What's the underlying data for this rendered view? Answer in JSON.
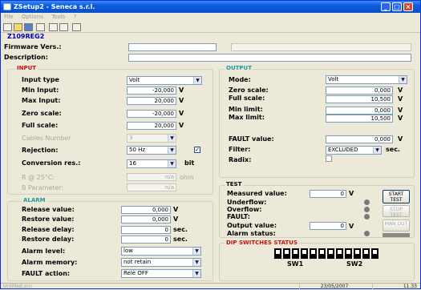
{
  "window": {
    "title": "ZSetup2 - Seneca s.r.l."
  },
  "menu": [
    "File",
    "Options",
    "Tools",
    "?"
  ],
  "device": {
    "model": "Z109REG2"
  },
  "header": {
    "firmware_label": "Firmware Vers.:",
    "description_label": "Description:",
    "firmware_value": "",
    "description_value": ""
  },
  "input": {
    "title": "INPUT",
    "input_type_label": "Input type",
    "input_type_value": "Volt",
    "min_input_label": "Min Input:",
    "min_input_value": "-20,000",
    "min_input_unit": "V",
    "max_input_label": "Max Input:",
    "max_input_value": "20,000",
    "max_input_unit": "V",
    "zero_scale_label": "Zero scale:",
    "zero_scale_value": "-20,000",
    "zero_scale_unit": "V",
    "full_scale_label": "Full scale:",
    "full_scale_value": "20,000",
    "full_scale_unit": "V",
    "cables_label": "Cables Number",
    "cables_value": "3",
    "rejection_label": "Rejection:",
    "rejection_value": "50 Hz",
    "conversion_label": "Conversion res.:",
    "conversion_value": "16",
    "conversion_unit": "bit",
    "r25_label": "R @ 25°C:",
    "r25_value": "n/a",
    "r25_unit": "ohm",
    "b_param_label": "B Parameter:",
    "b_param_value": "n/a"
  },
  "alarm": {
    "title": "ALARM",
    "release_value_label": "Release value:",
    "release_value": "0,000",
    "release_unit": "V",
    "restore_value_label": "Restore value:",
    "restore_value": "0,000",
    "restore_unit": "V",
    "release_delay_label": "Release delay:",
    "release_delay": "0",
    "release_delay_unit": "sec.",
    "restore_delay_label": "Restore delay:",
    "restore_delay": "0",
    "restore_delay_unit": "sec.",
    "alarm_level_label": "Alarm level:",
    "alarm_level_value": "low",
    "alarm_memory_label": "Alarm memory:",
    "alarm_memory_value": "not retain",
    "fault_action_label": "FAULT action:",
    "fault_action_value": "Relè OFF"
  },
  "output": {
    "title": "OUTPUT",
    "mode_label": "Mode:",
    "mode_value": "Volt",
    "zero_scale_label": "Zero scale:",
    "zero_scale_value": "0,000",
    "zero_scale_unit": "V",
    "full_scale_label": "Full scale:",
    "full_scale_value": "10,500",
    "full_scale_unit": "V",
    "min_limit_label": "Min limit:",
    "min_limit_value": "0,000",
    "min_limit_unit": "V",
    "max_limit_label": "Max limit:",
    "max_limit_value": "10,500",
    "max_limit_unit": "V",
    "fault_value_label": "FAULT value:",
    "fault_value": "0,000",
    "fault_value_unit": "V",
    "filter_label": "Filter:",
    "filter_value": "EXCLUDED",
    "filter_unit": "sec.",
    "radix_label": "Radix:"
  },
  "test": {
    "title": "TEST",
    "measured_label": "Measured value:",
    "measured_value": "0",
    "measured_unit": "V",
    "underflow_label": "Underflow:",
    "overflow_label": "Overflow:",
    "fault_label": "FAULT:",
    "output_value_label": "Output value:",
    "output_value": "0",
    "output_unit": "V",
    "alarm_status_label": "Alarm status:",
    "start_button": "START TEST",
    "stop_button": "STOP TEST",
    "man_out_button": "MAN OUT"
  },
  "dip": {
    "title": "DIP SWITCHES STATUS",
    "sw1": "SW1",
    "sw2": "SW2"
  },
  "status": {
    "file": "Untitled.zcn",
    "date": "23/05/2007",
    "time": "11.33"
  },
  "colors": {
    "accent_red": "#C81010",
    "accent_cyan": "#1C9C9C",
    "title_blue": "#0A5BDE"
  }
}
